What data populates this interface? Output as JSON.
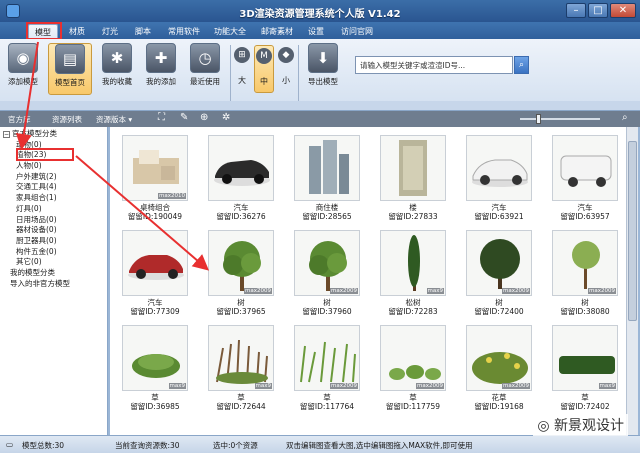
{
  "window": {
    "title": "3D渲染资源管理系统个人版 V1.42"
  },
  "menu": {
    "tabs": [
      "模型",
      "材质",
      "灯光",
      "脚本",
      "常用软件",
      "功能大全",
      "邮寄素材",
      "设置",
      "访问官网"
    ],
    "active": 0
  },
  "ribbon": {
    "add_model": "添加模型",
    "model_home": "模型首页",
    "my_favorites": "我的收藏",
    "my_added": "我的添加",
    "recent_used": "最近使用",
    "size_large": "大",
    "size_medium": "中",
    "size_small": "小",
    "export_model": "导出模型",
    "search_placeholder": "请输入模型关键字或渲渲ID号..."
  },
  "toolbar2": {
    "official_lib": "官方库",
    "resource_list": "资源列表",
    "resource_version": "资源版本 ▾"
  },
  "tree": {
    "root": "官方模型分类",
    "items": [
      "动物(0)",
      "植物(23)",
      "人物(0)",
      "户外建筑(2)",
      "交通工具(4)",
      "家具组合(1)",
      "灯具(0)",
      "日用场品(0)",
      "器材设备(0)",
      "厨卫器具(0)",
      "构件五金(0)",
      "其它(0)"
    ],
    "mine": "我的模型分类",
    "import_official": "导入的非官方模型"
  },
  "assets": [
    {
      "name": "桌椅组合",
      "id": "留留ID:190049",
      "icon": "furniture",
      "badge": "max2010"
    },
    {
      "name": "汽车",
      "id": "留留ID:36276",
      "icon": "black-sedan",
      "badge": ""
    },
    {
      "name": "商住楼",
      "id": "留留ID:28565",
      "icon": "towers",
      "badge": ""
    },
    {
      "name": "楼",
      "id": "留留ID:27833",
      "icon": "building",
      "badge": ""
    },
    {
      "name": "汽车",
      "id": "留留ID:63921",
      "icon": "white-car",
      "badge": ""
    },
    {
      "name": "汽车",
      "id": "留留ID:63957",
      "icon": "white-van",
      "badge": ""
    },
    {
      "name": "汽车",
      "id": "留留ID:77309",
      "icon": "red-car",
      "badge": ""
    },
    {
      "name": "树",
      "id": "留留ID:37965",
      "icon": "tree",
      "badge": "max2009"
    },
    {
      "name": "树",
      "id": "留留ID:37960",
      "icon": "tree",
      "badge": "max2009"
    },
    {
      "name": "松树",
      "id": "留留ID:72283",
      "icon": "cypress",
      "badge": "max9"
    },
    {
      "name": "树",
      "id": "留留ID:72400",
      "icon": "round-tree",
      "badge": "max2009"
    },
    {
      "name": "树",
      "id": "留留ID:38080",
      "icon": "small-tree",
      "badge": "max2009"
    },
    {
      "name": "草",
      "id": "留留ID:36985",
      "icon": "grass",
      "badge": "max9"
    },
    {
      "name": "草",
      "id": "留留ID:72644",
      "icon": "shrub",
      "badge": "max9"
    },
    {
      "name": "草",
      "id": "留留ID:117764",
      "icon": "grass2",
      "badge": "max2009"
    },
    {
      "name": "草",
      "id": "留留ID:117759",
      "icon": "grass3",
      "badge": "max2009"
    },
    {
      "name": "花草",
      "id": "留留ID:19168",
      "icon": "flowers",
      "badge": "max2009"
    },
    {
      "name": "草",
      "id": "留留ID:72402",
      "icon": "hedge",
      "badge": "max9"
    }
  ],
  "status": {
    "total": "模型总数:30",
    "query_total": "当前查询资源数:30",
    "selected": "选中:0个资源",
    "hint": "双击编辑图查看大图,选中编辑图拖入MAX软件,即可使用"
  },
  "watermark": "新景观设计",
  "colors": {
    "titlebar": "#2f5f9b",
    "ribbon": "#dfe9f5",
    "annotation": "#e83030"
  }
}
